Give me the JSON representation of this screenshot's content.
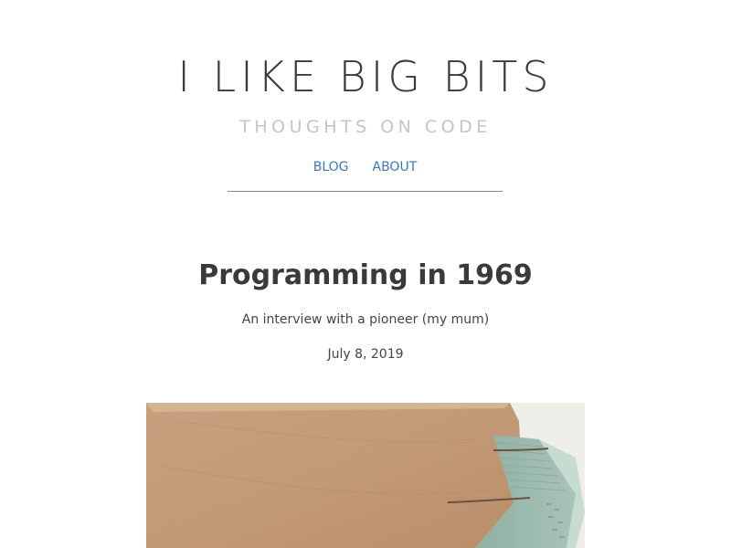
{
  "site": {
    "title": "I LIKE BIG BITS",
    "subtitle": "THOUGHTS ON CODE"
  },
  "nav": {
    "items": [
      {
        "label": "BLOG"
      },
      {
        "label": "ABOUT"
      }
    ],
    "link_color": "#3d78ad"
  },
  "post": {
    "title": "Programming in 1969",
    "subtitle": "An interview with a pioneer (my mum)",
    "date": "July 8, 2019",
    "image_icon": "punched-card-box-photo-icon"
  }
}
